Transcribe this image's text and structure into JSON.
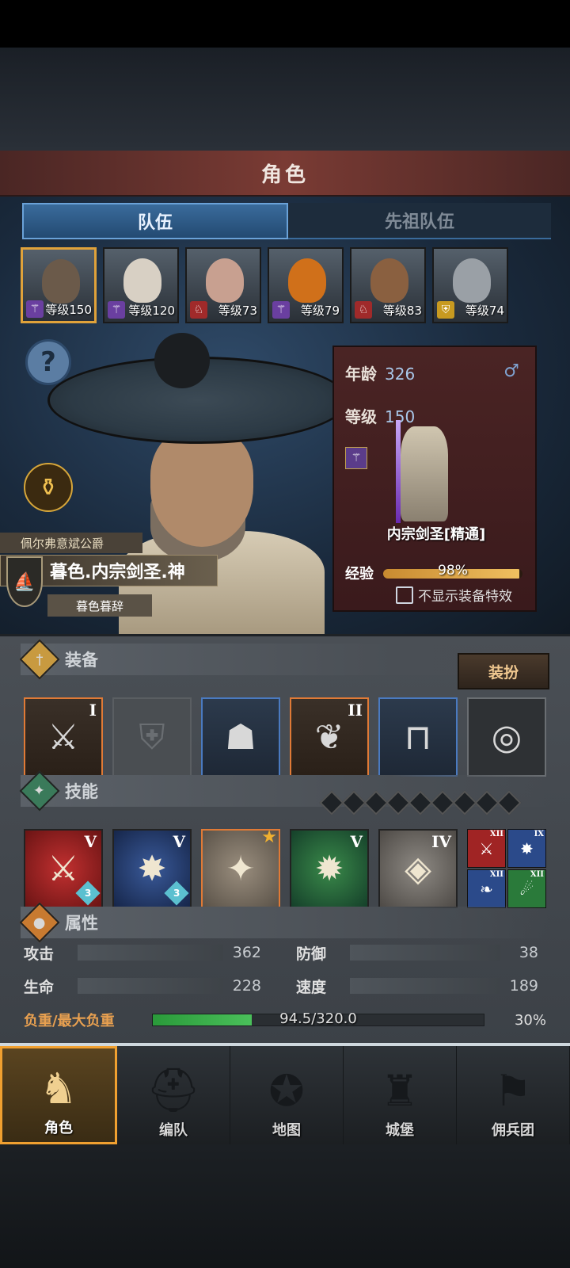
{
  "header": {
    "title": "角色"
  },
  "tabs": [
    {
      "label": "队伍",
      "active": true
    },
    {
      "label": "先祖队伍",
      "active": false
    }
  ],
  "roster": [
    {
      "level": "等级150",
      "class_icon": "wand-icon",
      "class_color": "#6a3fa0",
      "face_color": "#6b5a4a",
      "selected": true
    },
    {
      "level": "等级120",
      "class_icon": "wand-icon",
      "class_color": "#6a3fa0",
      "face_color": "#d8d0c4",
      "selected": false
    },
    {
      "level": "等级73",
      "class_icon": "beast-icon",
      "class_color": "#a02a2a",
      "face_color": "#c8a090",
      "selected": false
    },
    {
      "level": "等级79",
      "class_icon": "wand-icon",
      "class_color": "#6a3fa0",
      "face_color": "#d0701a",
      "selected": false
    },
    {
      "level": "等级83",
      "class_icon": "beast-icon",
      "class_color": "#a02a2a",
      "face_color": "#8a6040",
      "selected": false
    },
    {
      "level": "等级74",
      "class_icon": "shield-icon",
      "class_color": "#c89a20",
      "face_color": "#9aa0a6",
      "selected": false
    }
  ],
  "hero": {
    "title": "佩尔弗意斌公爵",
    "name": "暮色.内宗剑圣.神",
    "subtitle": "暮色暮辞"
  },
  "info": {
    "age_label": "年龄",
    "age": "326",
    "level_label": "等级",
    "level": "150",
    "gender": "♂",
    "class_name": "内宗剑圣[精通]",
    "exp_label": "经验",
    "exp_text": "98%",
    "exp_value": 0.98,
    "hide_fx_label": "不显示装备特效"
  },
  "equipment": {
    "section_label": "装备",
    "outfit_button": "装扮",
    "slots": [
      {
        "type": "orange",
        "glyph": "⚔",
        "tier": "I"
      },
      {
        "type": "empty",
        "glyph": "⛨",
        "tier": ""
      },
      {
        "type": "blue",
        "glyph": "☗",
        "tier": ""
      },
      {
        "type": "orange",
        "glyph": "❦",
        "tier": "II"
      },
      {
        "type": "blue",
        "glyph": "⊓",
        "tier": ""
      },
      {
        "type": "gray",
        "glyph": "◎",
        "tier": ""
      }
    ]
  },
  "skills": {
    "section_label": "技能",
    "main": [
      {
        "type": "red",
        "glyph": "⚔",
        "tier": "V",
        "count": "3"
      },
      {
        "type": "navy",
        "glyph": "✸",
        "tier": "V",
        "count": "3"
      },
      {
        "type": "tan",
        "glyph": "✦",
        "tier": "",
        "count": "",
        "star": "★"
      },
      {
        "type": "green",
        "glyph": "✹",
        "tier": "V",
        "count": ""
      },
      {
        "type": "stone",
        "glyph": "◈",
        "tier": "IV",
        "count": ""
      }
    ],
    "passives": [
      {
        "type": "r",
        "glyph": "⚔",
        "tier": "XII"
      },
      {
        "type": "n",
        "glyph": "✸",
        "tier": "IX"
      },
      {
        "type": "n",
        "glyph": "❧",
        "tier": "XII"
      },
      {
        "type": "g",
        "glyph": "☄",
        "tier": "XII"
      }
    ]
  },
  "attributes": {
    "section_label": "属性",
    "attack_label": "攻击",
    "attack": "362",
    "defense_label": "防御",
    "defense": "38",
    "hp_label": "生命",
    "hp": "228",
    "speed_label": "速度",
    "speed": "189",
    "load_label": "负重/最大负重",
    "load_text": "94.5/320.0",
    "load_pct": "30%",
    "load_value": 0.3
  },
  "nav": [
    {
      "label": "角色",
      "icon": "knight-icon",
      "glyph": "♞",
      "active": true
    },
    {
      "label": "编队",
      "icon": "helmet-icon",
      "glyph": "⛑",
      "active": false
    },
    {
      "label": "地图",
      "icon": "compass-icon",
      "glyph": "✪",
      "active": false
    },
    {
      "label": "城堡",
      "icon": "castle-icon",
      "glyph": "♜",
      "active": false
    },
    {
      "label": "佣兵团",
      "icon": "banner-icon",
      "glyph": "⚑",
      "active": false
    }
  ]
}
